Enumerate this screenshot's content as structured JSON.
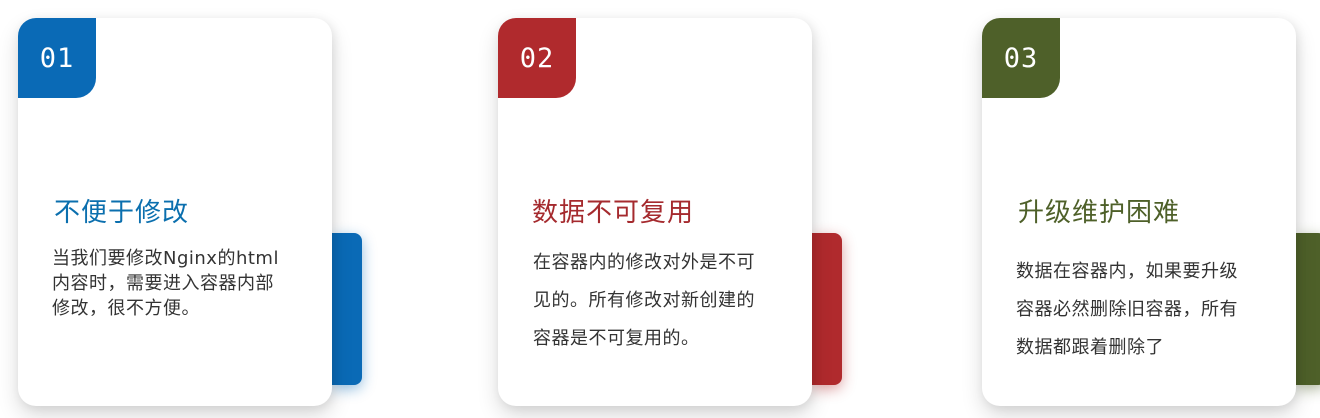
{
  "cards": [
    {
      "number": "01",
      "title": "不便于修改",
      "lines": [
        "当我们要修改Nginx的html",
        "内容时，需要进入容器内部",
        "修改，很不方便。"
      ],
      "color": "#0A6AB6"
    },
    {
      "number": "02",
      "title": "数据不可复用",
      "lines": [
        "在容器内的修改对外是不可",
        "见的。所有修改对新创建的",
        "容器是不可复用的。"
      ],
      "color": "#B02A2D"
    },
    {
      "number": "03",
      "title": "升级维护困难",
      "lines": [
        "数据在容器内，如果要升级",
        "容器必然删除旧容器，所有",
        "数据都跟着删除了"
      ],
      "color": "#4E6029"
    }
  ]
}
